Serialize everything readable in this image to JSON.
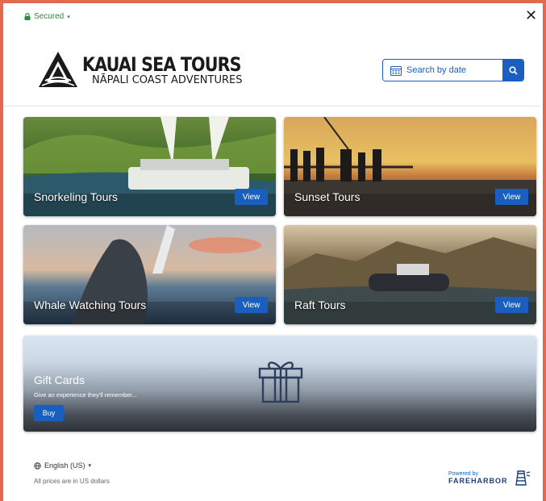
{
  "header": {
    "secured_label": "Secured",
    "close_symbol": "✕",
    "logo_title": "KAUAI SEA TOURS",
    "logo_subtitle": "NĀPALI COAST ADVENTURES"
  },
  "search": {
    "placeholder": "Search by date",
    "calendar_icon": "calendar-icon",
    "button_icon": "search-icon"
  },
  "tours": [
    {
      "label": "Snorkeling Tours",
      "button": "View"
    },
    {
      "label": "Sunset Tours",
      "button": "View"
    },
    {
      "label": "Whale Watching Tours",
      "button": "View"
    },
    {
      "label": "Raft Tours",
      "button": "View"
    }
  ],
  "gift_card": {
    "title": "Gift Cards",
    "subtitle": "Give an experience they'll remember...",
    "button": "Buy",
    "icon": "gift-icon"
  },
  "footer": {
    "language": "English (US)",
    "prices_note": "All prices are in US dollars",
    "powered_by": "Powered by",
    "provider": "FAREHARBOR"
  },
  "colors": {
    "accent": "#1a5fbf",
    "secured_green": "#2c8a3e",
    "frame_border": "#e0694f"
  }
}
